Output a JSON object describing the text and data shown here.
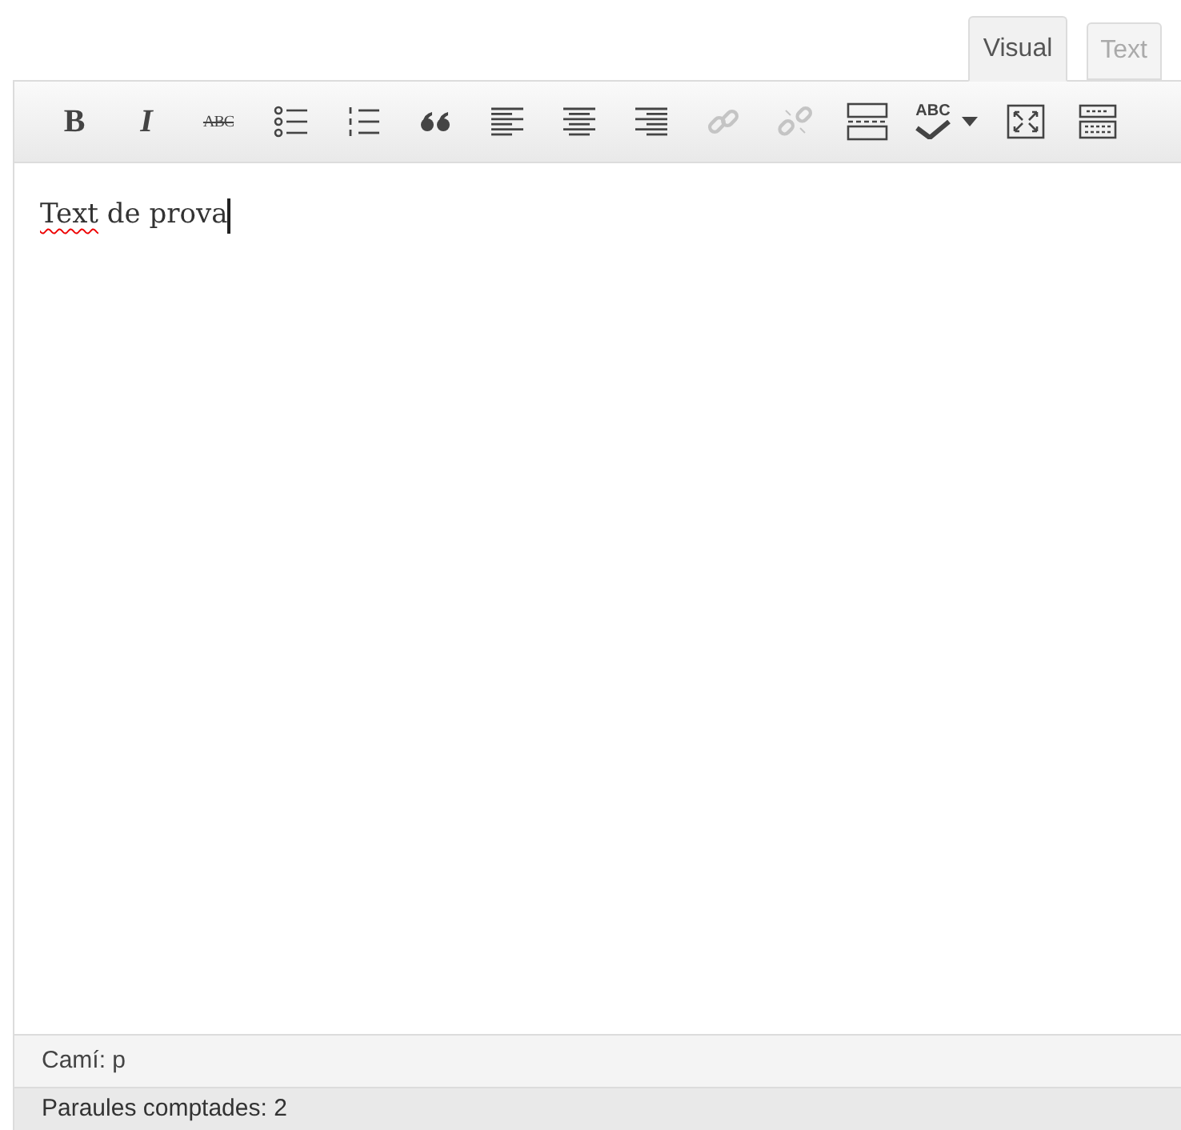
{
  "tabs": [
    {
      "label": "Visual",
      "selected": true
    },
    {
      "label": "Text",
      "selected": false
    }
  ],
  "toolbar": [
    {
      "kind": "bold",
      "label": "B",
      "disabled": false
    },
    {
      "kind": "italic",
      "label": "I",
      "disabled": false
    },
    {
      "kind": "strike",
      "label": "ABC",
      "disabled": false
    },
    {
      "kind": "bullets",
      "disabled": false
    },
    {
      "kind": "numbers",
      "disabled": false
    },
    {
      "kind": "quote",
      "disabled": false
    },
    {
      "kind": "align-left",
      "disabled": false
    },
    {
      "kind": "align-center",
      "disabled": false
    },
    {
      "kind": "align-right",
      "disabled": false
    },
    {
      "kind": "link",
      "disabled": true
    },
    {
      "kind": "unlink",
      "disabled": true
    },
    {
      "kind": "more",
      "disabled": false
    },
    {
      "kind": "spell",
      "label": "ABC",
      "disabled": false
    },
    {
      "kind": "fullscreen",
      "disabled": false
    },
    {
      "kind": "kitchen",
      "disabled": false
    }
  ],
  "editor": {
    "misspelled": "Text",
    "rest": " de prova"
  },
  "path": "Camí: p",
  "word_count": "Paraules comptades: 2"
}
